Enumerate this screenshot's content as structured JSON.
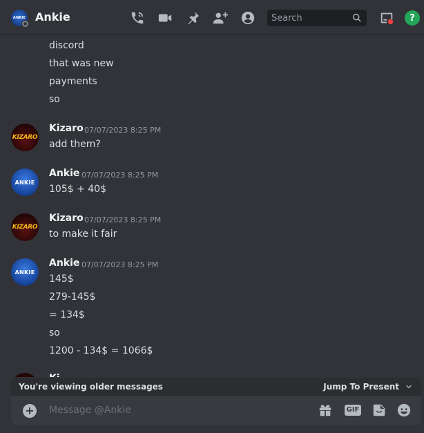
{
  "header": {
    "dm_name": "Ankie",
    "avatar_text": "ANKIE",
    "search_placeholder": "Search",
    "help_label": "?"
  },
  "messages": {
    "continued_lines": [
      "discord",
      "that was new",
      "payments",
      "so"
    ],
    "groups": [
      {
        "author": "Kizaro",
        "avatar": "KIZARO",
        "timestamp": "07/07/2023 8:25 PM",
        "lines": [
          "add them?"
        ]
      },
      {
        "author": "Ankie",
        "avatar": "ANKIE",
        "timestamp": "07/07/2023 8:25 PM",
        "lines": [
          "105$ + 40$"
        ]
      },
      {
        "author": "Kizaro",
        "avatar": "KIZARO",
        "timestamp": "07/07/2023 8:25 PM",
        "lines": [
          "to make it fair"
        ]
      },
      {
        "author": "Ankie",
        "avatar": "ANKIE",
        "timestamp": "07/07/2023 8:25 PM",
        "lines": [
          "145$",
          "279-145$",
          "= 134$",
          "so",
          "1200 - 134$ = 1066$"
        ]
      }
    ],
    "partial_author": "Ki"
  },
  "banner": {
    "text": "You're viewing older messages",
    "jump_label": "Jump To Present"
  },
  "composer": {
    "placeholder": "Message @Ankie",
    "add_label": "+",
    "gif_label": "GIF"
  },
  "colors": {
    "background": "#313338",
    "help_green": "#23a55a",
    "inbox_badge_red": "#f23f43"
  }
}
